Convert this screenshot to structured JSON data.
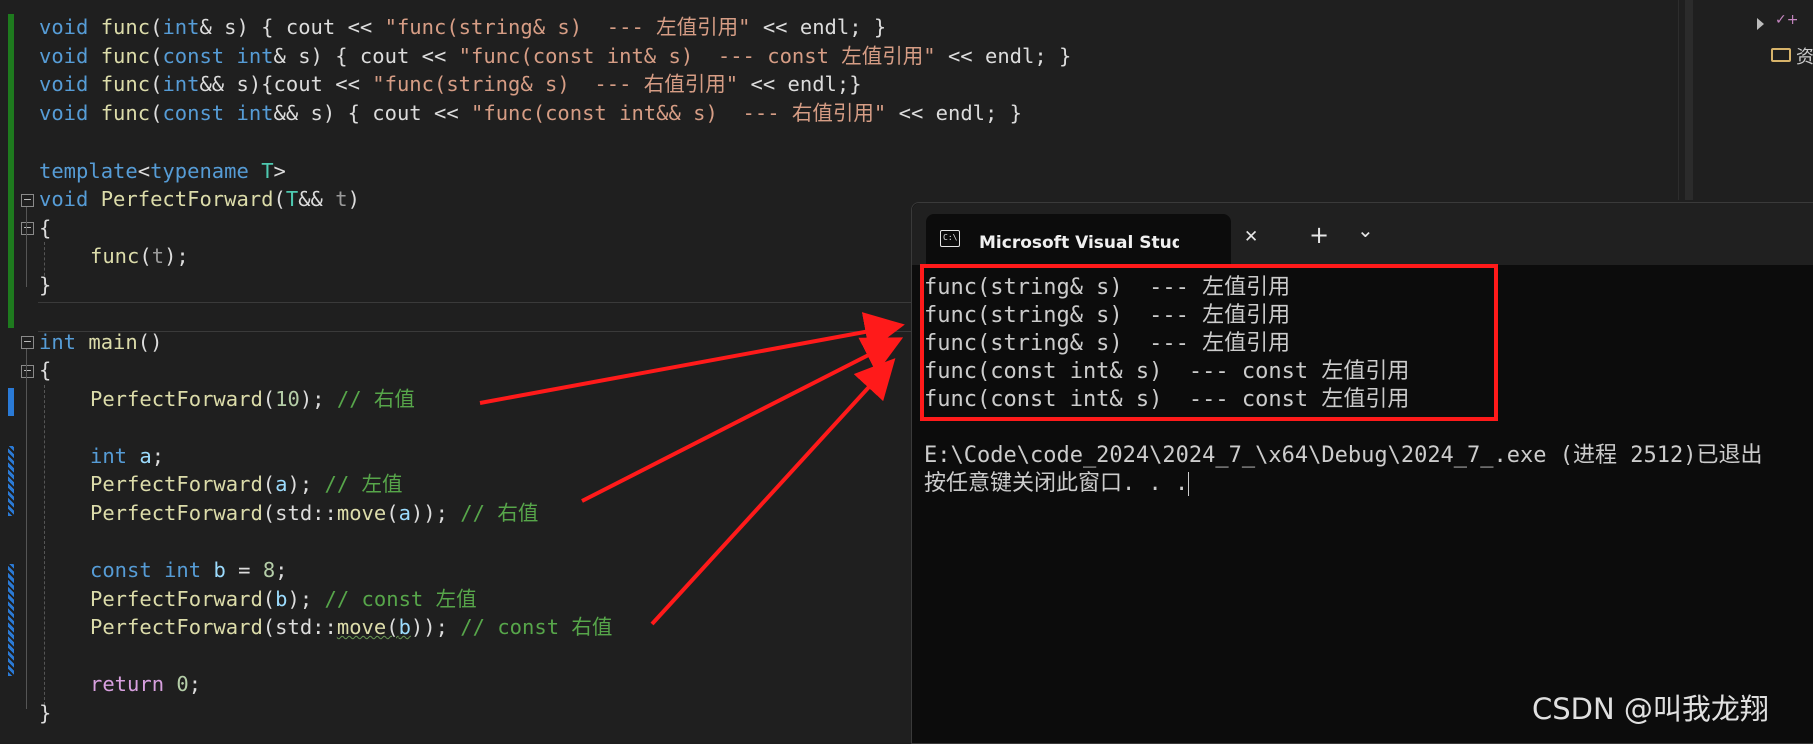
{
  "editor": {
    "lines": {
      "l1": {
        "a": "void",
        "b": " ",
        "c": "func",
        "d": "(",
        "e": "int",
        "f": "& s) { cout << ",
        "g": "\"func(string& s)  --- 左值引用\"",
        "h": " << endl; }"
      },
      "l2": {
        "a": "void",
        "b": " ",
        "c": "func",
        "d": "(",
        "e": "const",
        "f": " ",
        "g": "int",
        "h": "& s) { cout << ",
        "i": "\"func(const int& s)  --- const 左值引用\"",
        "j": " << endl; }"
      },
      "l3": {
        "a": "void",
        "b": " ",
        "c": "func",
        "d": "(",
        "e": "int",
        "f": "&& s){cout << ",
        "g": "\"func(string& s)  --- 右值引用\"",
        "h": " << endl;}"
      },
      "l4": {
        "a": "void",
        "b": " ",
        "c": "func",
        "d": "(",
        "e": "const",
        "f": " ",
        "g": "int",
        "h": "&& s) { cout << ",
        "i": "\"func(const int&& s)  --- 右值引用\"",
        "j": " << endl; }"
      },
      "l6": {
        "a": "template",
        "b": "<",
        "c": "typename",
        "d": " ",
        "e": "T",
        "f": ">"
      },
      "l7": {
        "a": "void",
        "b": " ",
        "c": "PerfectForward",
        "d": "(",
        "e": "T",
        "f": "&& ",
        "g": "t",
        "h": ")"
      },
      "l8": {
        "a": "{"
      },
      "l9": {
        "a": "func",
        "b": "(",
        "c": "t",
        "d": ");"
      },
      "l10": {
        "a": "}"
      },
      "l12": {
        "a": "int",
        "b": " ",
        "c": "main",
        "d": "()"
      },
      "l13": {
        "a": "{"
      },
      "l14": {
        "a": "PerfectForward",
        "b": "(",
        "c": "10",
        "d": "); ",
        "e": "// 右值"
      },
      "l16": {
        "a": "int",
        "b": " ",
        "c": "a",
        "d": ";"
      },
      "l17": {
        "a": "PerfectForward",
        "b": "(",
        "c": "a",
        "d": "); ",
        "e": "// 左值"
      },
      "l18": {
        "a": "PerfectForward",
        "b": "(std::",
        "c": "move",
        "d": "(",
        "e": "a",
        "f": ")); ",
        "g": "// 右值"
      },
      "l20": {
        "a": "const",
        "b": " ",
        "c": "int",
        "d": " ",
        "e": "b",
        "f": " = ",
        "g": "8",
        "h": ";"
      },
      "l21": {
        "a": "PerfectForward",
        "b": "(",
        "c": "b",
        "d": "); ",
        "e": "// const 左值"
      },
      "l22": {
        "a": "PerfectForward",
        "b": "(std::",
        "c": "move",
        "d": "(",
        "e": "b",
        "f": ")); ",
        "g": "// const 右值"
      },
      "l24": {
        "a": "return",
        "b": " ",
        "c": "0",
        "d": ";"
      },
      "l25": {
        "a": "}"
      }
    },
    "fold_symbol": "−"
  },
  "solution_pane": {
    "item1_text": "资"
  },
  "terminal": {
    "tab_title": "Microsoft Visual Studio 调试控制台",
    "icon_text": "C:\\",
    "close_glyph": "✕",
    "new_tab_glyph": "+",
    "dropdown_glyph": "⌄",
    "output": [
      "func(string& s)  --- 左值引用",
      "func(string& s)  --- 左值引用",
      "func(string& s)  --- 左值引用",
      "func(const int& s)  --- const 左值引用",
      "func(const int& s)  --- const 左值引用"
    ],
    "exit_line": "E:\\Code\\code_2024\\2024_7_\\x64\\Debug\\2024_7_.exe (进程 2512)已退出",
    "prompt_line": "按任意键关闭此窗口. . ."
  },
  "watermark": "CSDN @叫我龙翔",
  "colors": {
    "annotation_red": "#ff1a1a",
    "keyword": "#569cd6",
    "function": "#dcdcaa",
    "string": "#d69d85",
    "comment": "#57a64a"
  }
}
